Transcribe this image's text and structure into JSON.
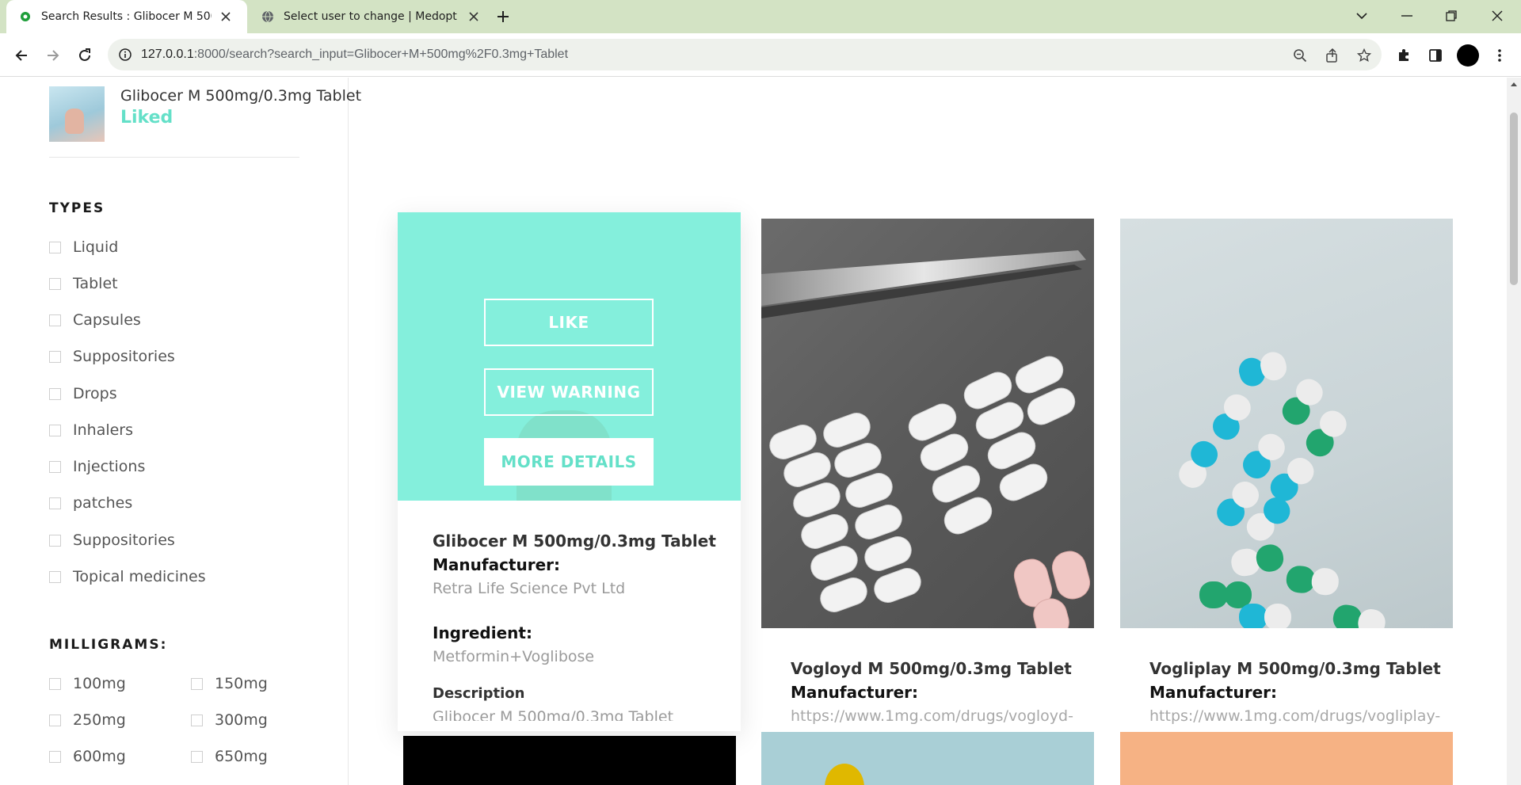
{
  "browser": {
    "tabs": [
      {
        "title": "Search Results : Glibocer M 500mg/0.3mg Tablet",
        "active": true
      },
      {
        "title": "Select user to change | Medopt Admin",
        "active": false
      }
    ],
    "url_host": "127.0.0.1",
    "url_path": ":8000/search?search_input=Glibocer+M+500mg%2F0.3mg+Tablet"
  },
  "sidebar": {
    "liked": {
      "name": "Glibocer M 500mg/0.3mg Tablet",
      "status": "Liked"
    },
    "types_title": "TYPES",
    "types": [
      "Liquid",
      "Tablet",
      "Capsules",
      "Suppositories",
      "Drops",
      "Inhalers",
      "Injections",
      "patches",
      "Suppositories",
      "Topical medicines"
    ],
    "mg_title": "MILLIGRAMS:",
    "milligrams": [
      "100mg",
      "150mg",
      "250mg",
      "300mg",
      "600mg",
      "650mg"
    ]
  },
  "featured": {
    "like_label": "LIKE",
    "warning_label": "VIEW WARNING",
    "details_label": "MORE DETAILS",
    "name": "Glibocer M 500mg/0.3mg Tablet",
    "manufacturer_label": "Manufacturer:",
    "manufacturer": "Retra Life Science Pvt Ltd",
    "ingredient_label": "Ingredient:",
    "ingredient": "Metformin+Voglibose",
    "description_label": "Description",
    "description": "Glibocer M 500mg/0.3mg Tablet"
  },
  "products": [
    {
      "name": "Vogloyd M 500mg/0.3mg Tablet",
      "manufacturer_label": "Manufacturer:",
      "manufacturer": "https://www.1mg.com/drugs/vogloyd-"
    },
    {
      "name": "Vogliplay M 500mg/0.3mg Tablet",
      "manufacturer_label": "Manufacturer:",
      "manufacturer": "https://www.1mg.com/drugs/vogliplay-"
    }
  ],
  "colors": {
    "accent": "#64e0c8",
    "overlay": "#84efdc",
    "tabbar": "#d3e3c4"
  }
}
